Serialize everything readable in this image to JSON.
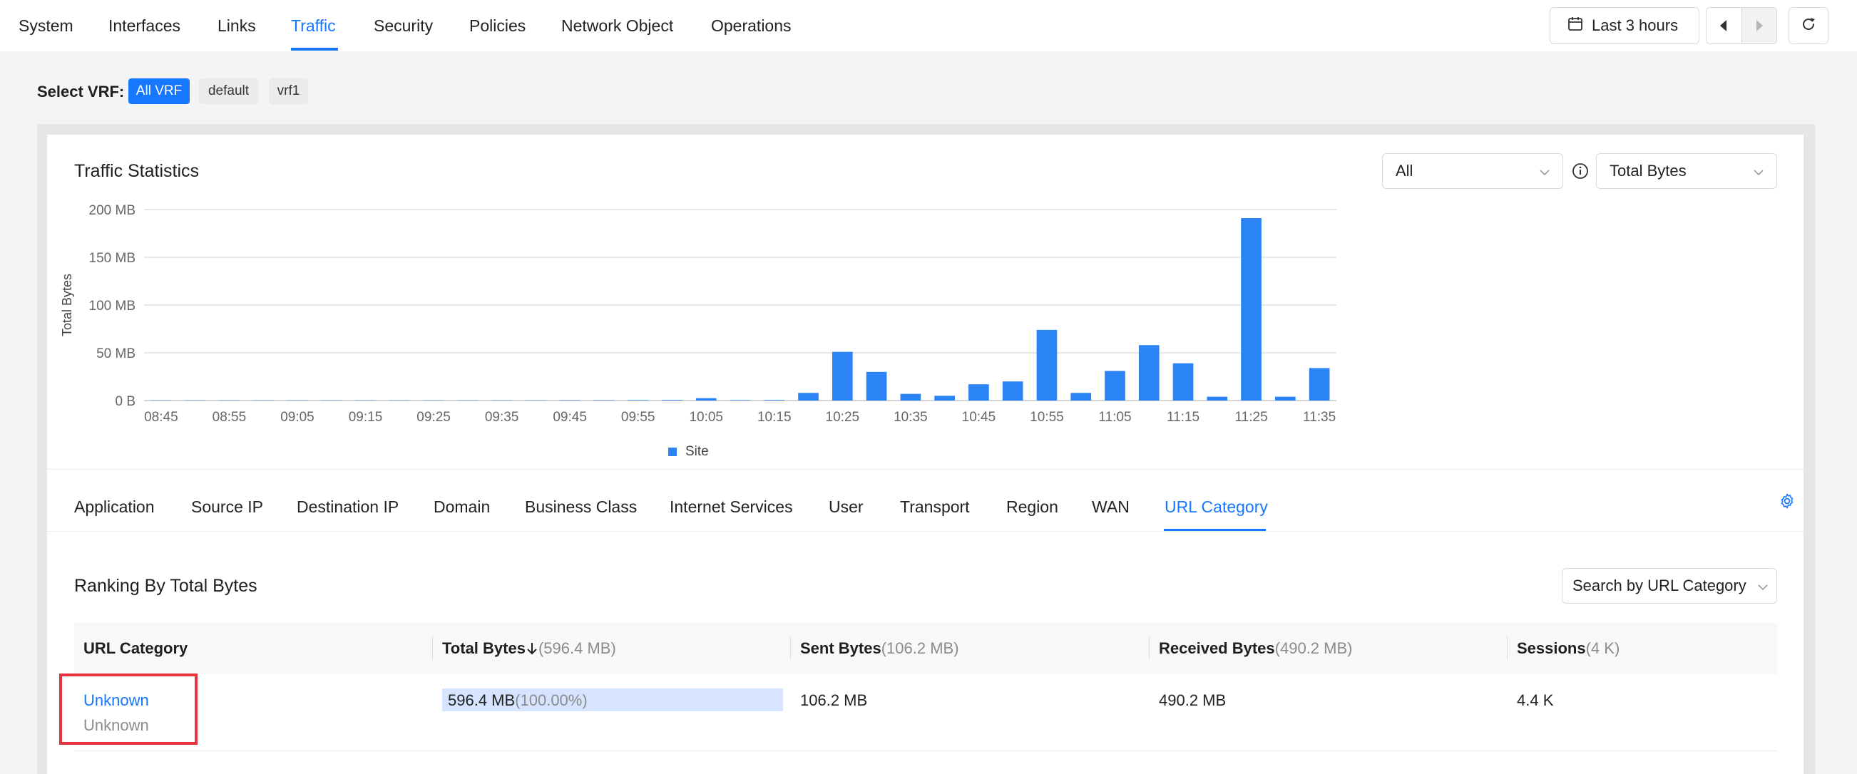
{
  "nav": {
    "items": [
      "System",
      "Interfaces",
      "Links",
      "Traffic",
      "Security",
      "Policies",
      "Network Object",
      "Operations"
    ],
    "active": "Traffic"
  },
  "toolbar": {
    "time_range": "Last 3 hours",
    "calendar_icon": "calendar-icon",
    "prev_icon": "caret-left-icon",
    "next_icon": "caret-right-icon",
    "refresh_icon": "refresh-icon"
  },
  "vrf": {
    "label": "Select VRF:",
    "options": [
      "All VRF",
      "default",
      "vrf1"
    ],
    "selected": "All VRF"
  },
  "traffic_stats": {
    "title": "Traffic Statistics",
    "filter_value": "All",
    "metric_value": "Total Bytes",
    "info_icon": "info-icon"
  },
  "chart_data": {
    "type": "bar",
    "ylabel": "Total Bytes",
    "xlabel": "",
    "y_ticks": [
      "0 B",
      "50 MB",
      "100 MB",
      "150 MB",
      "200 MB"
    ],
    "ylim": [
      0,
      200
    ],
    "x_tick_labels": [
      "08:45",
      "08:55",
      "09:05",
      "09:15",
      "09:25",
      "09:35",
      "09:45",
      "09:55",
      "10:05",
      "10:15",
      "10:25",
      "10:35",
      "10:45",
      "10:55",
      "11:05",
      "11:15",
      "11:25",
      "11:35"
    ],
    "series": [
      {
        "name": "Site",
        "color": "#2a84f6",
        "x": [
          "08:45",
          "08:50",
          "08:55",
          "09:00",
          "09:05",
          "09:10",
          "09:15",
          "09:20",
          "09:25",
          "09:30",
          "09:35",
          "09:40",
          "09:45",
          "09:50",
          "09:55",
          "10:00",
          "10:05",
          "10:10",
          "10:15",
          "10:20",
          "10:25",
          "10:30",
          "10:35",
          "10:40",
          "10:45",
          "10:50",
          "10:55",
          "11:00",
          "11:05",
          "11:10",
          "11:15",
          "11:20",
          "11:25",
          "11:30",
          "11:35"
        ],
        "values": [
          0.3,
          0.3,
          0.3,
          0.3,
          0.3,
          0.3,
          0.3,
          0.3,
          0.3,
          0.3,
          0.3,
          0.3,
          0.4,
          0.4,
          0.5,
          0.6,
          2.5,
          0.5,
          0.6,
          8,
          51,
          30,
          7,
          5,
          17,
          20,
          74,
          8,
          31,
          58,
          39,
          4,
          191,
          4,
          34
        ]
      }
    ],
    "legend_position": "bottom-center",
    "grid": true
  },
  "dimension_tabs": {
    "items": [
      "Application",
      "Source IP",
      "Destination IP",
      "Domain",
      "Business Class",
      "Internet Services",
      "User",
      "Transport",
      "Region",
      "WAN",
      "URL Category"
    ],
    "active": "URL Category",
    "settings_icon": "gear-icon"
  },
  "ranking": {
    "title": "Ranking By Total Bytes",
    "search_placeholder": "Search by URL Category",
    "columns": [
      {
        "label": "URL Category",
        "total": ""
      },
      {
        "label": "Total Bytes",
        "total": "(596.4 MB)",
        "sort_icon": "arrow-down-icon"
      },
      {
        "label": "Sent Bytes",
        "total": "(106.2 MB)"
      },
      {
        "label": "Received Bytes",
        "total": "(490.2 MB)"
      },
      {
        "label": "Sessions",
        "total": "(4 K)"
      }
    ],
    "rows": [
      {
        "category": "Unknown",
        "category_sub": "Unknown",
        "total_bytes": "596.4 MB",
        "total_pct": "(100.00%)",
        "total_fraction": 1.0,
        "sent_bytes": "106.2 MB",
        "received_bytes": "490.2 MB",
        "sessions": "4.4 K"
      }
    ]
  }
}
